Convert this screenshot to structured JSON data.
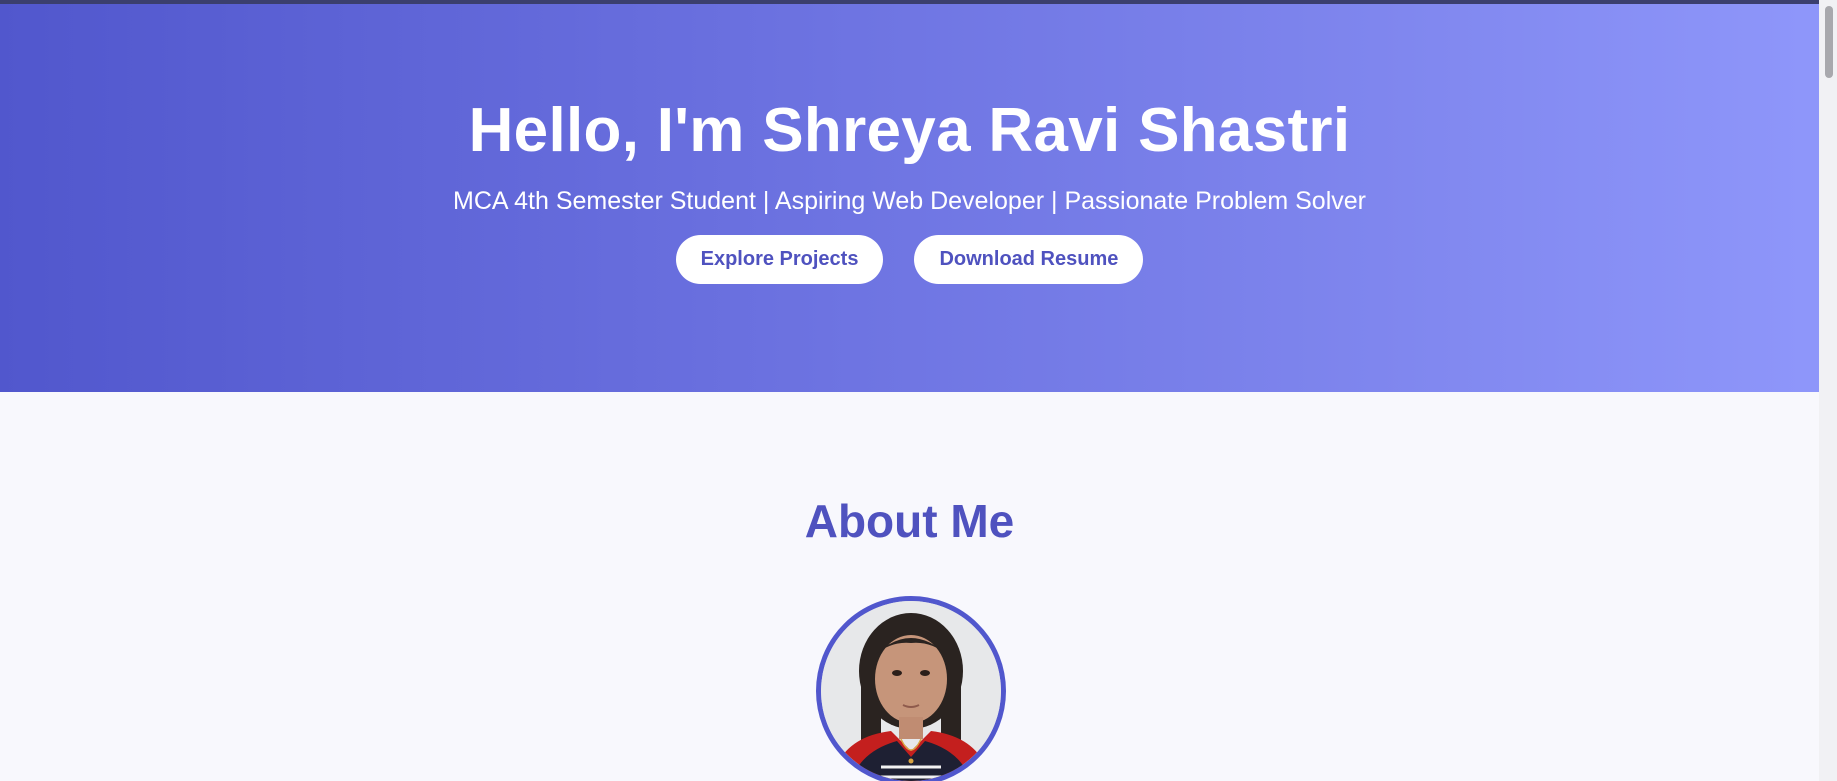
{
  "hero": {
    "title": "Hello, I'm Shreya Ravi Shastri",
    "subtitle": "MCA 4th Semester Student | Aspiring Web Developer | Passionate Problem Solver",
    "buttons": {
      "explore": "Explore Projects",
      "resume": "Download Resume"
    }
  },
  "about": {
    "title": "About Me",
    "photo_icon": "profile-photo"
  },
  "colors": {
    "gradient_start": "#5157cd",
    "gradient_end": "#8f97fb",
    "accent": "#4f52bf",
    "background": "#f8f8fd"
  }
}
